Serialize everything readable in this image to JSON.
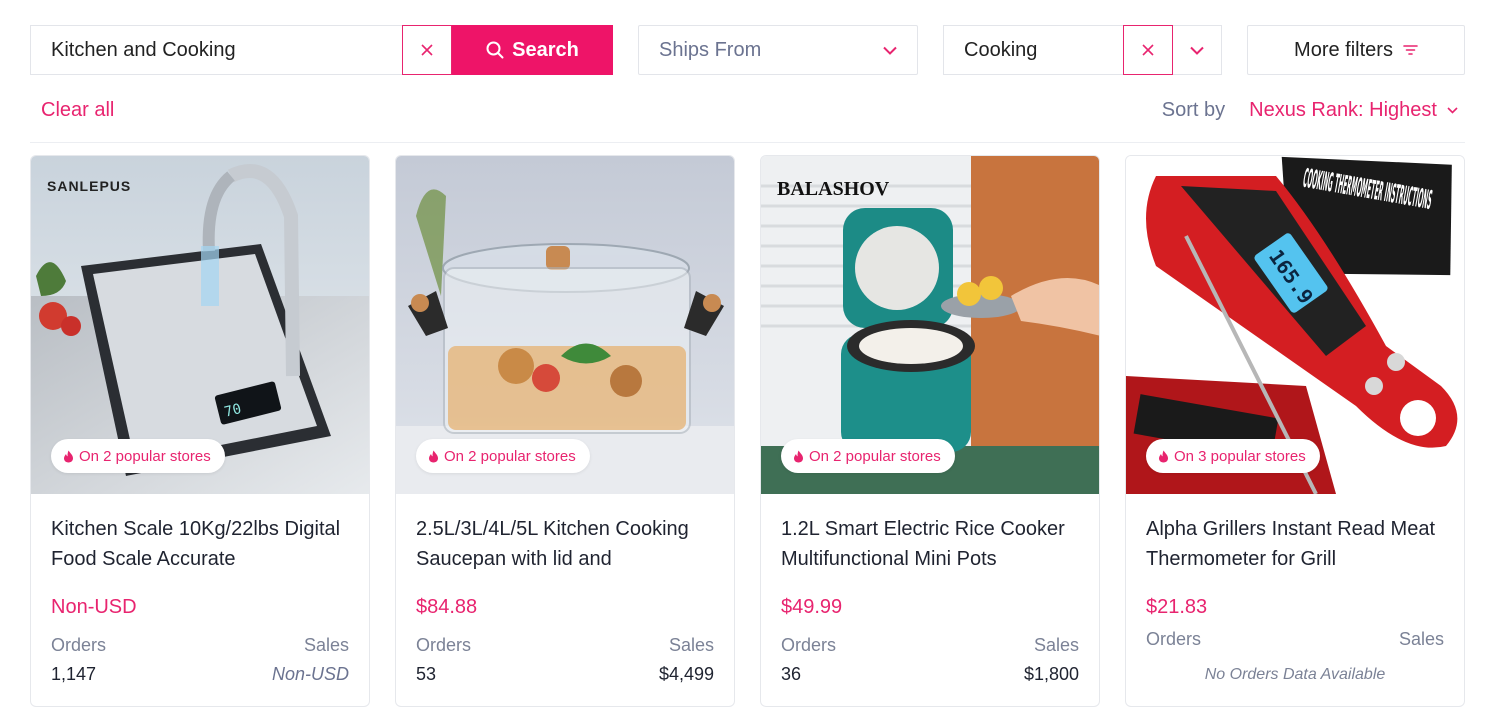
{
  "search": {
    "value": "Kitchen and Cooking",
    "button_label": "Search"
  },
  "filters": {
    "ships_from_placeholder": "Ships From",
    "category_value": "Cooking",
    "more_filters_label": "More filters"
  },
  "toolbar": {
    "clear_all_label": "Clear all",
    "sort_label": "Sort by",
    "sort_value": "Nexus Rank: Highest"
  },
  "colors": {
    "accent": "#ee1468",
    "muted_text": "#6b7390"
  },
  "products": [
    {
      "brand": "SANLEPUS",
      "badge": "On 2 popular stores",
      "title": "Kitchen Scale 10Kg/22lbs Digital Food Scale Accurate",
      "price": "Non-USD",
      "orders_label": "Orders",
      "sales_label": "Sales",
      "orders": "1,147",
      "sales": "Non-USD"
    },
    {
      "brand": "",
      "badge": "On 2 popular stores",
      "title": "2.5L/3L/4L/5L Kitchen Cooking Saucepan with lid and",
      "price": "$84.88",
      "orders_label": "Orders",
      "sales_label": "Sales",
      "orders": "53",
      "sales": "$4,499"
    },
    {
      "brand": "BALASHOV",
      "badge": "On 2 popular stores",
      "title": "1.2L Smart Electric Rice Cooker Multifunctional Mini Pots",
      "price": "$49.99",
      "orders_label": "Orders",
      "sales_label": "Sales",
      "orders": "36",
      "sales": "$1,800"
    },
    {
      "brand": "",
      "image_text": "COOKING THERMOMETER INSTRUCTIONS",
      "display_reading": "165.9",
      "badge": "On 3 popular stores",
      "title": "Alpha Grillers Instant Read Meat Thermometer for Grill",
      "price": "$21.83",
      "orders_label": "Orders",
      "sales_label": "Sales",
      "no_data": "No Orders Data Available"
    }
  ]
}
